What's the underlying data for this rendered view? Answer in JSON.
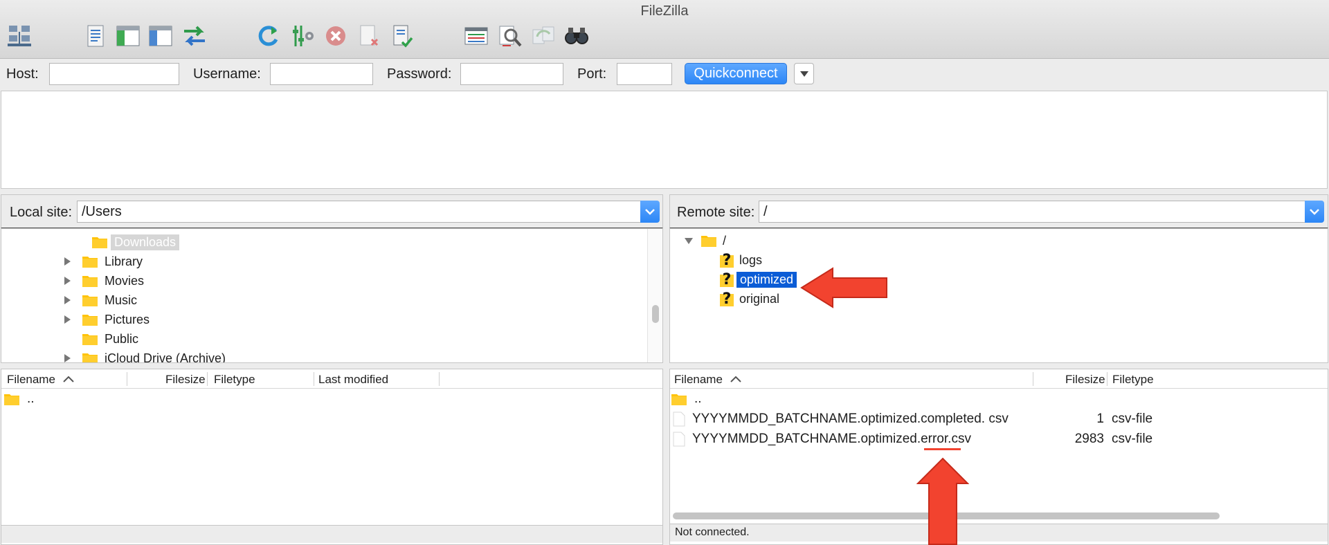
{
  "window": {
    "title": "FileZilla"
  },
  "toolbar": {
    "buttons": [
      {
        "name": "site-manager-icon"
      },
      {
        "name": "toggle-message-log-icon"
      },
      {
        "name": "toggle-local-tree-icon"
      },
      {
        "name": "toggle-remote-tree-icon"
      },
      {
        "name": "transfer-queue-icon"
      },
      {
        "name": "refresh-icon"
      },
      {
        "name": "process-queue-icon"
      },
      {
        "name": "cancel-operation-icon"
      },
      {
        "name": "disconnect-icon"
      },
      {
        "name": "reconnect-icon"
      },
      {
        "name": "directory-listing-filters-icon"
      },
      {
        "name": "toggle-directory-comparison-icon"
      },
      {
        "name": "synchronized-browsing-icon"
      },
      {
        "name": "search-remote-files-icon"
      }
    ]
  },
  "quickconnect": {
    "host_label": "Host:",
    "host_value": "",
    "username_label": "Username:",
    "username_value": "",
    "password_label": "Password:",
    "password_value": "",
    "port_label": "Port:",
    "port_value": "",
    "button_label": "Quickconnect"
  },
  "local": {
    "site_label": "Local site:",
    "path": "/Users",
    "tree": [
      {
        "label": "Downloads",
        "expander": false,
        "selected": "grey"
      },
      {
        "label": "Library",
        "expander": true
      },
      {
        "label": "Movies",
        "expander": true
      },
      {
        "label": "Music",
        "expander": true
      },
      {
        "label": "Pictures",
        "expander": true
      },
      {
        "label": "Public",
        "expander": false
      },
      {
        "label": "iCloud Drive (Archive)",
        "expander": true
      }
    ],
    "columns": [
      "Filename",
      "Filesize",
      "Filetype",
      "Last modified"
    ],
    "files": [
      {
        "name": "..",
        "size": "",
        "type": ""
      }
    ]
  },
  "remote": {
    "site_label": "Remote site:",
    "path": "/",
    "tree_root": "/",
    "tree": [
      {
        "label": "logs"
      },
      {
        "label": "optimized",
        "selected": "blue"
      },
      {
        "label": "original"
      }
    ],
    "columns": [
      "Filename",
      "Filesize",
      "Filetype"
    ],
    "files": [
      {
        "name": "..",
        "size": "",
        "type": ""
      },
      {
        "name": "YYYYMMDD_BATCHNAME.optimized.completed. csv",
        "size": "1",
        "type": "csv-file"
      },
      {
        "name": "YYYYMMDD_BATCHNAME.optimized.error.csv",
        "size": "2983",
        "type": "csv-file"
      }
    ],
    "status": "Not connected."
  },
  "colors": {
    "folder": "#ffc30a",
    "accent_blue": "#2c86f6",
    "selection_blue": "#0b5cd6",
    "annotation_red": "#f2432f"
  }
}
